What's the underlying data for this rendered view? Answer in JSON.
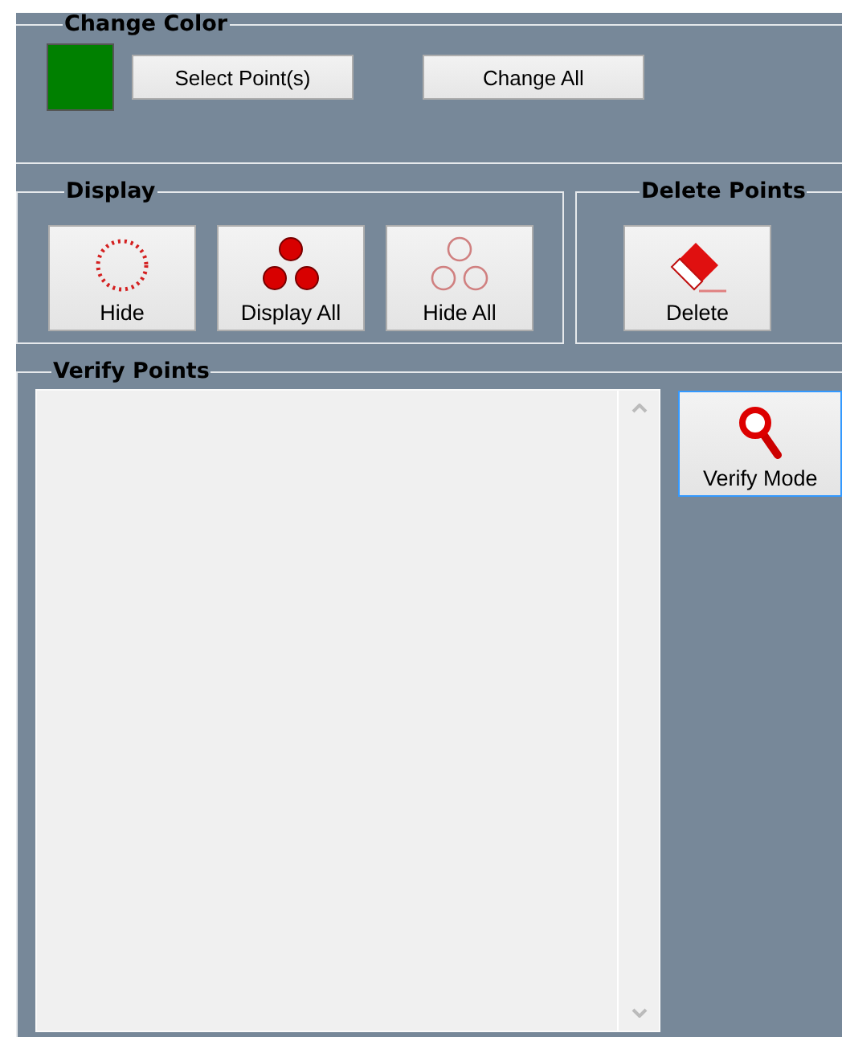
{
  "change_color": {
    "title": "Change Color",
    "swatch": {
      "color": "#008000"
    },
    "buttons": [
      "Select Point(s)",
      "Change All"
    ]
  },
  "display": {
    "title": "Display",
    "buttons": [
      "Hide",
      "Display All",
      "Hide All"
    ]
  },
  "delete_points": {
    "title": "Delete Points",
    "buttons": [
      "Delete"
    ]
  },
  "verify_points": {
    "title": "Verify Points",
    "verify_button": {
      "label": "Verify Mode",
      "focused": true
    }
  }
}
